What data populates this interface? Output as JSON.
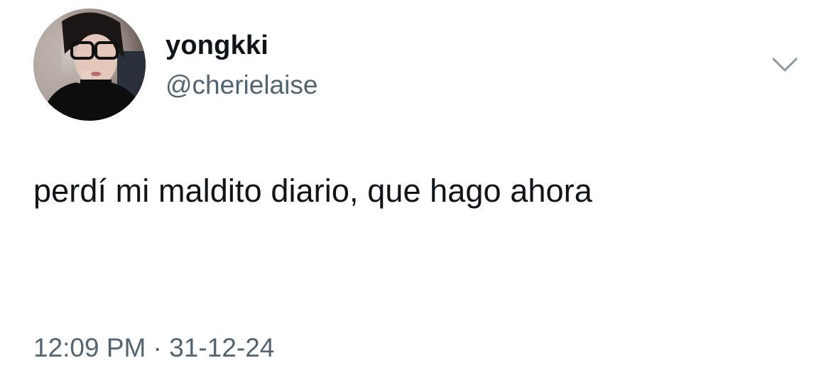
{
  "tweet": {
    "author": {
      "display_name": "yongkki",
      "handle": "@cherielaise",
      "avatar_icon": "profile-photo"
    },
    "menu_icon": "chevron-down-icon",
    "text": "perdí mi maldito diario, que hago ahora",
    "time": "12:09 PM",
    "separator": " · ",
    "date": "31-12-24"
  },
  "colors": {
    "text": "#0f1419",
    "secondary": "#536471",
    "caret": "#8b98a5",
    "background": "#ffffff"
  }
}
